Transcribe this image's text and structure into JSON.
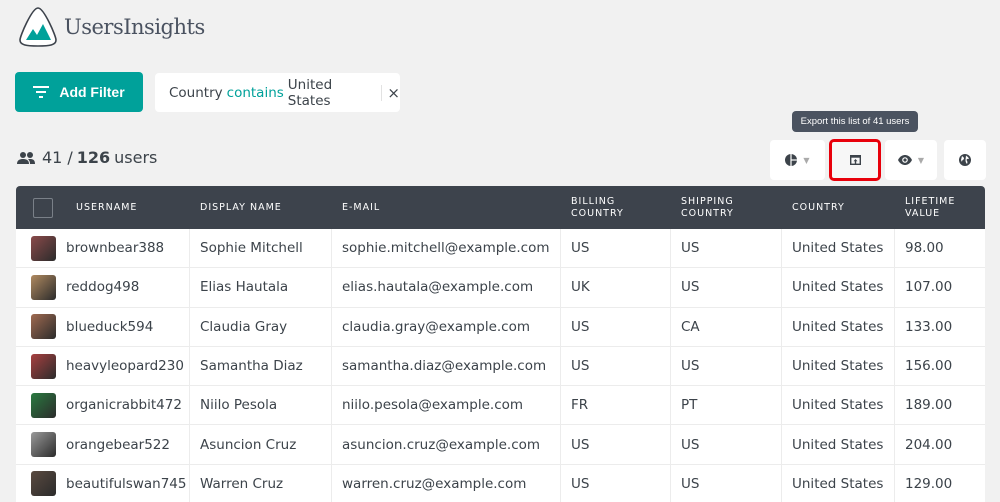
{
  "app": {
    "name": "UsersInsights",
    "brand_color": "#00a19a",
    "header_color": "#3d434c"
  },
  "filters": {
    "add_label": "Add Filter",
    "active": [
      {
        "field": "Country",
        "operator": "contains",
        "value": "United States"
      }
    ],
    "remove_icon": "×"
  },
  "summary": {
    "filtered": "41",
    "separator": "/",
    "total": "126",
    "unit": "users"
  },
  "toolbar": {
    "tooltip": "Export this list of 41 users",
    "buttons": [
      {
        "name": "segments",
        "icon": "pie-chart-icon",
        "has_dropdown": true
      },
      {
        "name": "export",
        "icon": "export-icon",
        "highlighted": true
      },
      {
        "name": "columns",
        "icon": "eye-icon",
        "has_dropdown": true
      },
      {
        "name": "map",
        "icon": "globe-icon"
      }
    ]
  },
  "table": {
    "columns": [
      {
        "line1": "USERNAME",
        "line2": ""
      },
      {
        "line1": "DISPLAY NAME",
        "line2": ""
      },
      {
        "line1": "E-MAIL",
        "line2": ""
      },
      {
        "line1": "BILLING",
        "line2": "COUNTRY"
      },
      {
        "line1": "SHIPPING",
        "line2": "COUNTRY"
      },
      {
        "line1": "COUNTRY",
        "line2": ""
      },
      {
        "line1": "LIFETIME",
        "line2": "VALUE"
      }
    ],
    "rows": [
      {
        "username": "brownbear388",
        "display_name": "Sophie Mitchell",
        "email": "sophie.mitchell@example.com",
        "billing_country": "US",
        "shipping_country": "US",
        "country": "United States",
        "lifetime_value": "98.00",
        "avatar_color": "#8a4a4a"
      },
      {
        "username": "reddog498",
        "display_name": "Elias Hautala",
        "email": "elias.hautala@example.com",
        "billing_country": "UK",
        "shipping_country": "US",
        "country": "United States",
        "lifetime_value": "107.00",
        "avatar_color": "#b08a60"
      },
      {
        "username": "blueduck594",
        "display_name": "Claudia Gray",
        "email": "claudia.gray@example.com",
        "billing_country": "US",
        "shipping_country": "CA",
        "country": "United States",
        "lifetime_value": "133.00",
        "avatar_color": "#a06a50"
      },
      {
        "username": "heavyleopard230",
        "display_name": "Samantha Diaz",
        "email": "samantha.diaz@example.com",
        "billing_country": "US",
        "shipping_country": "US",
        "country": "United States",
        "lifetime_value": "156.00",
        "avatar_color": "#a84040"
      },
      {
        "username": "organicrabbit472",
        "display_name": "Niilo Pesola",
        "email": "niilo.pesola@example.com",
        "billing_country": "FR",
        "shipping_country": "PT",
        "country": "United States",
        "lifetime_value": "189.00",
        "avatar_color": "#2a7a40"
      },
      {
        "username": "orangebear522",
        "display_name": "Asuncion Cruz",
        "email": "asuncion.cruz@example.com",
        "billing_country": "US",
        "shipping_country": "US",
        "country": "United States",
        "lifetime_value": "204.00",
        "avatar_color": "#9a9a9a"
      },
      {
        "username": "beautifulswan745",
        "display_name": "Warren Cruz",
        "email": "warren.cruz@example.com",
        "billing_country": "US",
        "shipping_country": "US",
        "country": "United States",
        "lifetime_value": "129.00",
        "avatar_color": "#5a4a40"
      }
    ]
  }
}
